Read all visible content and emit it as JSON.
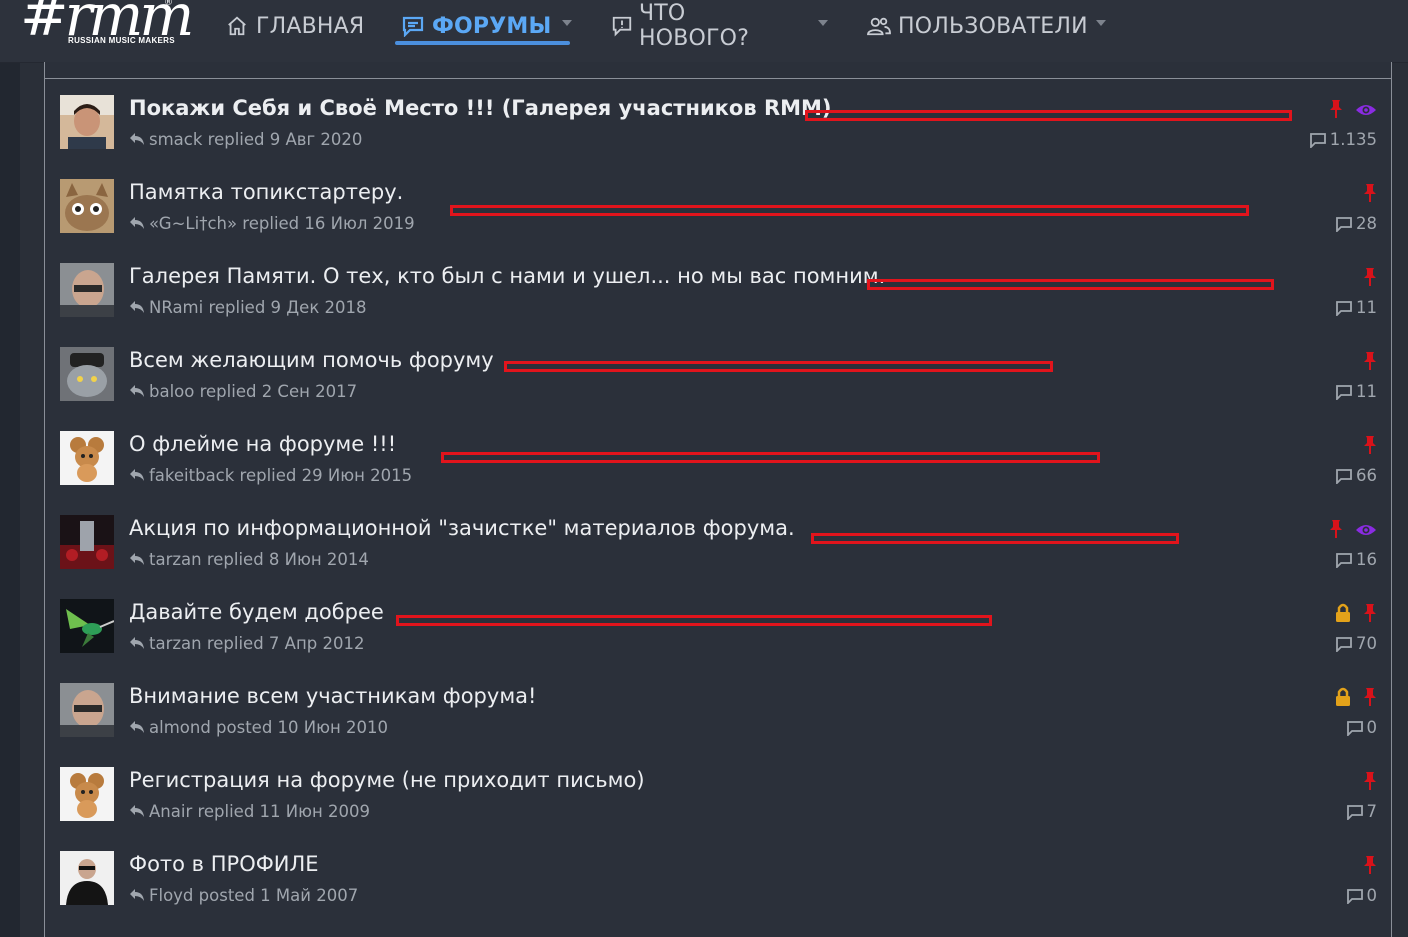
{
  "logo": {
    "mark": "#rmm",
    "sub": "RUSSIAN MUSIC MAKERS",
    "reg": "®"
  },
  "nav": {
    "items": [
      {
        "label": "ГЛАВНАЯ",
        "icon": "home-icon"
      },
      {
        "label": "ФОРУМЫ",
        "icon": "forum-icon",
        "active": true
      },
      {
        "label": "ЧТО НОВОГО?",
        "icon": "whats-new-icon"
      },
      {
        "label": "ПОЛЬЗОВАТЕЛИ",
        "icon": "users-icon"
      }
    ]
  },
  "colors": {
    "accent": "#5ba8f5",
    "pin": "#d9121a",
    "watch": "#8a2be2",
    "lock": "#e3a21a",
    "highlight_box": "#e1141c"
  },
  "threads": [
    {
      "title": "Покажи Себя и Своё Место !!! (Галерея участников RMM)",
      "bold": true,
      "meta": "smack replied 9 Авг 2020",
      "replies": "1.135",
      "pinned": true,
      "watched": true,
      "locked": false,
      "avatar": "avatar-man-photo"
    },
    {
      "title": "Памятка топикстартеру.",
      "bold": false,
      "meta": "«G~Li†ch» replied 16 Июл 2019",
      "replies": "28",
      "pinned": true,
      "watched": false,
      "locked": false,
      "avatar": "avatar-kitten-photo"
    },
    {
      "title": "Галерея Памяти. О тех, кто был с нами и ушел... но мы вас помним.",
      "bold": false,
      "meta": "NRami replied 9 Дек 2018",
      "replies": "11",
      "pinned": true,
      "watched": false,
      "locked": false,
      "avatar": "avatar-bald-man-photo"
    },
    {
      "title": "Всем желающим помочь форуму",
      "bold": false,
      "meta": "baloo replied 2 Сен 2017",
      "replies": "11",
      "pinned": true,
      "watched": false,
      "locked": false,
      "avatar": "avatar-cat-hat-photo"
    },
    {
      "title": "О флейме на форуме !!!",
      "bold": false,
      "meta": "fakeitback replied 29 Июн 2015",
      "replies": "66",
      "pinned": true,
      "watched": false,
      "locked": false,
      "avatar": "avatar-cartoon-mouse"
    },
    {
      "title": "Акция по информационной \"зачистке\" материалов форума.",
      "bold": false,
      "meta": "tarzan replied 8 Июн 2014",
      "replies": "16",
      "pinned": true,
      "watched": true,
      "locked": false,
      "avatar": "avatar-robocop-photo"
    },
    {
      "title": "Давайте будем добрее",
      "bold": false,
      "meta": "tarzan replied 7 Апр 2012",
      "replies": "70",
      "pinned": true,
      "watched": false,
      "locked": true,
      "avatar": "avatar-hummingbird"
    },
    {
      "title": "Внимание всем участникам форума!",
      "bold": false,
      "meta": "almond posted 10 Июн 2010",
      "replies": "0",
      "pinned": true,
      "watched": false,
      "locked": true,
      "avatar": "avatar-bald-man-photo"
    },
    {
      "title": "Регистрация на форуме (не приходит письмо)",
      "bold": false,
      "meta": "Anair replied 11 Июн 2009",
      "replies": "7",
      "pinned": true,
      "watched": false,
      "locked": false,
      "avatar": "avatar-cartoon-mouse"
    },
    {
      "title": "Фото в ПРОФИЛЕ",
      "bold": false,
      "meta": "Floyd posted 1 Май 2007",
      "replies": "0",
      "pinned": true,
      "watched": false,
      "locked": false,
      "avatar": "avatar-sunglasses-man"
    }
  ]
}
